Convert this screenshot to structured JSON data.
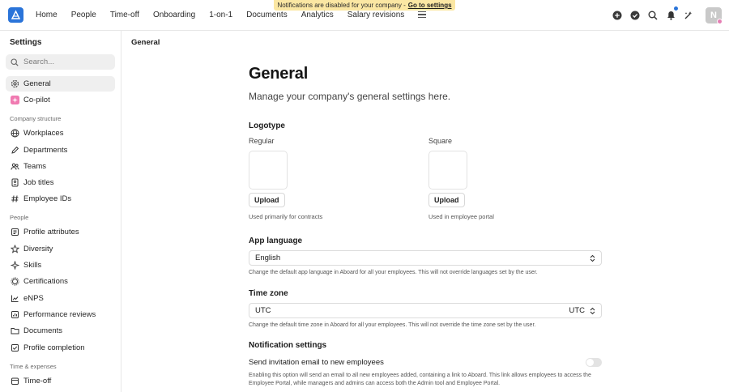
{
  "banner": {
    "text": "Notifications are disabled for your company -",
    "link": "Go to settings"
  },
  "nav": {
    "items": [
      "Home",
      "People",
      "Time-off",
      "Onboarding",
      "1-on-1",
      "Documents",
      "Analytics",
      "Salary revisions"
    ]
  },
  "user": {
    "avatar_initial": "N"
  },
  "sidebar": {
    "title": "Settings",
    "search_placeholder": "Search...",
    "top_items": [
      {
        "label": "General",
        "icon": "gear-icon"
      },
      {
        "label": "Co-pilot",
        "icon": "copilot-icon"
      }
    ],
    "sections": [
      {
        "title": "Company structure",
        "items": [
          {
            "label": "Workplaces",
            "icon": "globe-icon"
          },
          {
            "label": "Departments",
            "icon": "pen-icon"
          },
          {
            "label": "Teams",
            "icon": "team-icon"
          },
          {
            "label": "Job titles",
            "icon": "badge-icon"
          },
          {
            "label": "Employee IDs",
            "icon": "hash-icon"
          }
        ]
      },
      {
        "title": "People",
        "items": [
          {
            "label": "Profile attributes",
            "icon": "list-icon"
          },
          {
            "label": "Diversity",
            "icon": "star-icon"
          },
          {
            "label": "Skills",
            "icon": "sparkle-icon"
          },
          {
            "label": "Certifications",
            "icon": "award-icon"
          },
          {
            "label": "eNPS",
            "icon": "chart-icon"
          },
          {
            "label": "Performance reviews",
            "icon": "review-icon"
          },
          {
            "label": "Documents",
            "icon": "folder-icon"
          },
          {
            "label": "Profile completion",
            "icon": "checklist-icon"
          }
        ]
      },
      {
        "title": "Time & expenses",
        "items": [
          {
            "label": "Time-off",
            "icon": "calendar-icon"
          }
        ]
      }
    ]
  },
  "breadcrumb": "General",
  "main": {
    "title": "General",
    "subtitle": "Manage your company's general settings here.",
    "logotype": {
      "heading": "Logotype",
      "regular": {
        "label": "Regular",
        "button": "Upload",
        "hint": "Used primarily for contracts"
      },
      "square": {
        "label": "Square",
        "button": "Upload",
        "hint": "Used in employee portal"
      }
    },
    "app_language": {
      "heading": "App language",
      "value": "English",
      "hint": "Change the default app language in Aboard for all your employees. This will not override languages set by the user."
    },
    "time_zone": {
      "heading": "Time zone",
      "value": "UTC",
      "right_value": "UTC",
      "hint": "Change the default time zone in Aboard for all your employees. This will not override the time zone set by the user."
    },
    "notifications": {
      "heading": "Notification settings",
      "invite_label": "Send invitation email to new employees",
      "invite_enabled": false,
      "invite_hint": "Enabling this option will send an email to all new employees added, containing a link to Aboard. This link allows employees to access the Employee Portal, while managers and admins can access both the Admin tool and Employee Portal."
    }
  }
}
